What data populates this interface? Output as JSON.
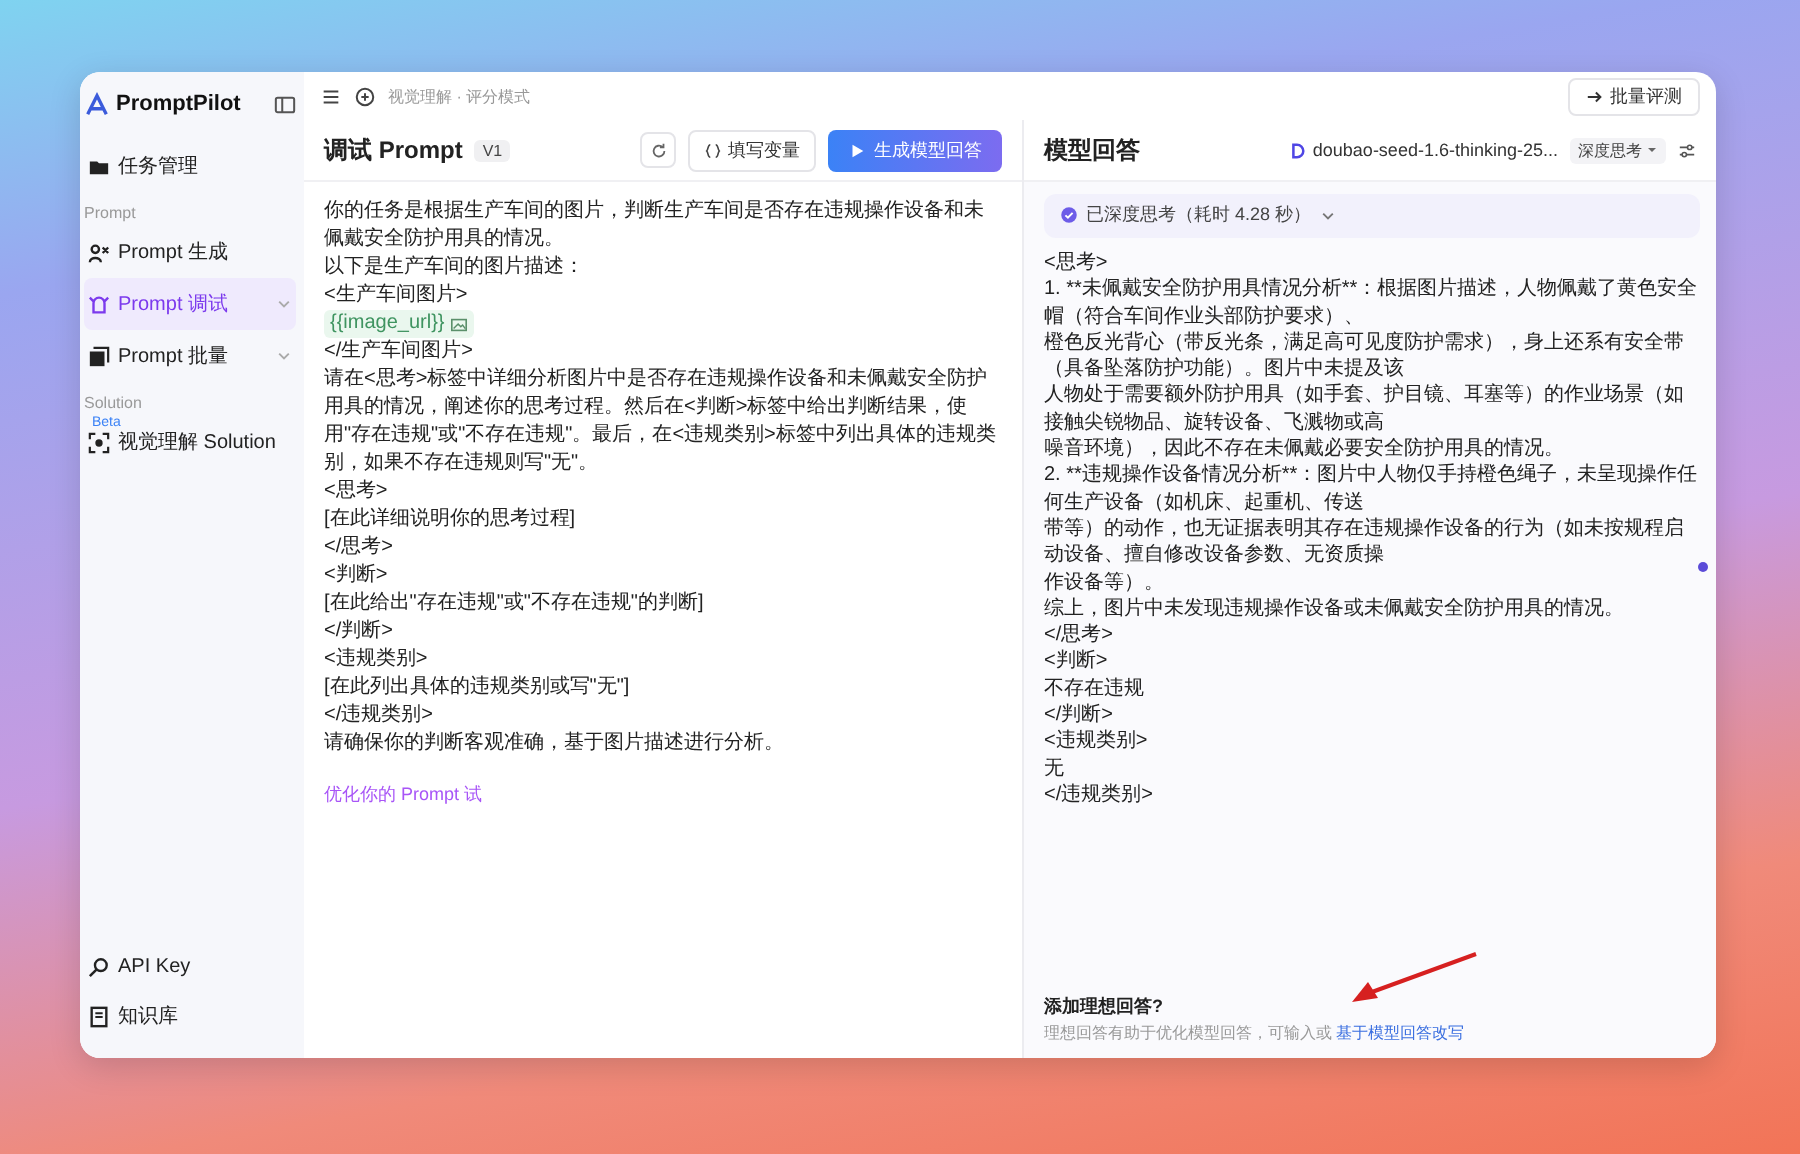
{
  "sidebar": {
    "logo": "PromptPilot",
    "groups": [
      {
        "items": [
          {
            "label": "任务管理",
            "selected": false
          }
        ]
      },
      {
        "heading": "Prompt",
        "items": [
          {
            "label": "Prompt 生成",
            "selected": false
          },
          {
            "label": "Prompt 调试",
            "selected": true,
            "expanded": false
          },
          {
            "label": "Prompt 批量",
            "selected": false,
            "expanded": false
          }
        ]
      },
      {
        "heading": "Solution",
        "items": [
          {
            "label": "视觉理解 Solution",
            "badge": "Beta",
            "selected": false
          }
        ]
      }
    ],
    "footer_items": [
      {
        "label": "API Key",
        "selected": false
      },
      {
        "label": "知识库",
        "selected": false
      }
    ]
  },
  "top_bar": {
    "subtitle": "视觉理解 · 评分模式",
    "action": "批量评测"
  },
  "prompt_panel": {
    "title": "调试 Prompt",
    "version": "V1",
    "fill_variables": "填写变量",
    "generate": "生成模型回答",
    "lines": [
      {
        "kind": "text",
        "text": "你的任务是根据生产车间的图片，判断生产车间是否存在违规操作设备和未佩戴安全防护用具的情况。"
      },
      {
        "kind": "text",
        "text": "以下是生产车间的图片描述："
      },
      {
        "kind": "text",
        "text": "<生产车间图片>"
      },
      {
        "kind": "variable",
        "text": "{{image_url}}"
      },
      {
        "kind": "text",
        "text": "</生产车间图片>"
      },
      {
        "kind": "text",
        "text": "请在<思考>标签中详细分析图片中是否存在违规操作设备和未佩戴安全防护用具的情况，阐述你的思考过程。然后在<判断>标签中给出判断结果，使用\"存在违规\"或\"不存在违规\"。最后，在<违规类别>标签中列出具体的违规类别，如果不存在违规则写\"无\"。"
      },
      {
        "kind": "text",
        "text": "<思考>"
      },
      {
        "kind": "text",
        "text": "[在此详细说明你的思考过程]"
      },
      {
        "kind": "text",
        "text": "</思考>"
      },
      {
        "kind": "text",
        "text": "<判断>"
      },
      {
        "kind": "text",
        "text": "[在此给出\"存在违规\"或\"不存在违规\"的判断]"
      },
      {
        "kind": "text",
        "text": "</判断>"
      },
      {
        "kind": "text",
        "text": "<违规类别>"
      },
      {
        "kind": "text",
        "text": "[在此列出具体的违规类别或写\"无\"]"
      },
      {
        "kind": "text",
        "text": "</违规类别>"
      },
      {
        "kind": "text",
        "text": "请确保你的判断客观准确，基于图片描述进行分析。"
      }
    ],
    "optimize_link": "优化你的 Prompt 试"
  },
  "response_panel": {
    "title": "模型回答",
    "model": "doubao-seed-1.6-thinking-25...",
    "mode": "深度思考",
    "thinking": {
      "label": "已深度思考（耗时 4.28 秒）",
      "expanded": false
    },
    "lines": [
      "<思考>",
      "1. **未佩戴安全防护用具情况分析**：根据图片描述，人物佩戴了黄色安全帽（符合车间作业头部防护要求）、",
      "橙色反光背心（带反光条，满足高可见度防护需求），身上还系有安全带（具备坠落防护功能）。图片中未提及该",
      "人物处于需要额外防护用具（如手套、护目镜、耳塞等）的作业场景（如接触尖锐物品、旋转设备、飞溅物或高",
      "噪音环境），因此不存在未佩戴必要安全防护用具的情况。",
      "2. **违规操作设备情况分析**：图片中人物仅手持橙色绳子，未呈现操作任何生产设备（如机床、起重机、传送",
      "带等）的动作，也无证据表明其存在违规操作设备的行为（如未按规程启动设备、擅自修改设备参数、无资质操",
      "作设备等）。",
      "综上，图片中未发现违规操作设备或未佩戴安全防护用具的情况。",
      "</思考>",
      "<判断>",
      "不存在违规",
      "</判断>",
      "<违规类别>",
      "无",
      "</违规类别>"
    ],
    "ideal_title": "添加理想回答?",
    "ideal_hint": "理想回答有助于优化模型回答，可输入或",
    "ideal_link": "基于模型回答改写"
  }
}
